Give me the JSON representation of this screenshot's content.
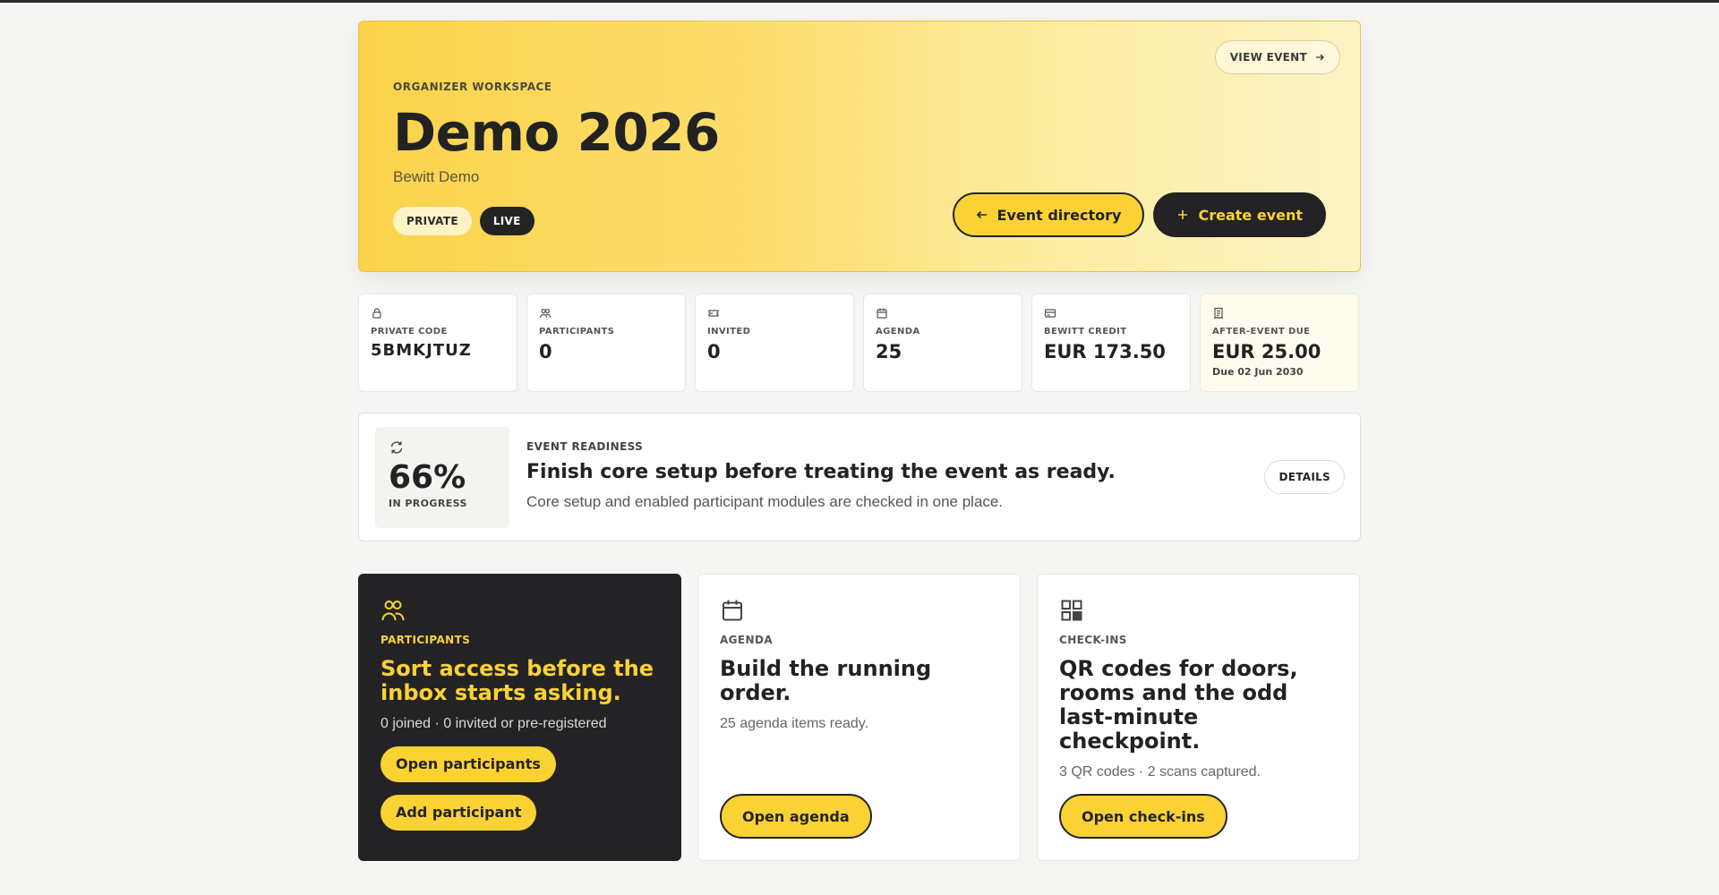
{
  "hero": {
    "eyebrow": "ORGANIZER WORKSPACE",
    "title": "Demo 2026",
    "subtitle": "Bewitt Demo",
    "badges": [
      "PRIVATE",
      "LIVE"
    ],
    "view_event_label": "VIEW EVENT",
    "event_directory_label": "Event directory",
    "create_event_label": "Create event"
  },
  "stats": [
    {
      "icon": "lock-icon",
      "label": "PRIVATE CODE",
      "value": "5BMKJTUZ"
    },
    {
      "icon": "users-icon",
      "label": "PARTICIPANTS",
      "value": "0"
    },
    {
      "icon": "ticket-icon",
      "label": "INVITED",
      "value": "0"
    },
    {
      "icon": "calendar-icon",
      "label": "AGENDA",
      "value": "25"
    },
    {
      "icon": "credit-card-icon",
      "label": "BEWITT CREDIT",
      "value": "EUR 173.50"
    },
    {
      "icon": "receipt-icon",
      "label": "AFTER-EVENT DUE",
      "value": "EUR 25.00",
      "sub": "Due 02 Jun 2030"
    }
  ],
  "readiness": {
    "percent": "66%",
    "progress": 0.66,
    "status": "IN PROGRESS",
    "eyebrow": "EVENT READINESS",
    "heading": "Finish core setup before treating the event as ready.",
    "description": "Core setup and enabled participant modules are checked in one place.",
    "details_label": "DETAILS"
  },
  "cards": [
    {
      "icon": "users-icon",
      "label": "PARTICIPANTS",
      "heading": "Sort access before the inbox starts asking.",
      "meta": "0 joined · 0 invited or pre-registered",
      "buttons": [
        "Open participants",
        "Add participant"
      ]
    },
    {
      "icon": "calendar-icon",
      "label": "AGENDA",
      "heading": "Build the running order.",
      "meta": "25 agenda items ready.",
      "button": "Open agenda"
    },
    {
      "icon": "qr-code-icon",
      "label": "CHECK-INS",
      "heading": "QR codes for doors, rooms and the odd last-minute checkpoint.",
      "meta": "3 QR codes · 2 scans captured.",
      "button": "Open check-ins"
    }
  ],
  "colors": {
    "accent": "#fbd234",
    "dark": "#232325",
    "background": "#f5f5f3"
  }
}
